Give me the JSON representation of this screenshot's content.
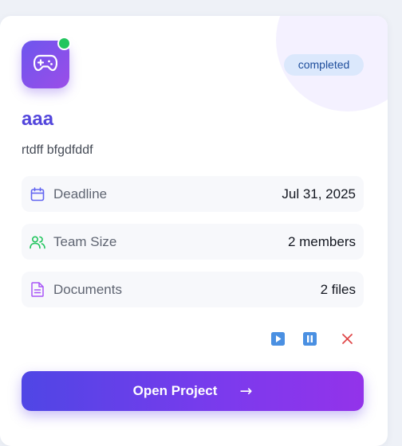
{
  "project": {
    "name": "aaa",
    "description": "rtdff bfgdfddf",
    "status": "completed",
    "icon": "gamepad-icon",
    "online": true
  },
  "details": [
    {
      "icon": "calendar-icon",
      "label": "Deadline",
      "value": "Jul 31, 2025",
      "color": "#6366f1"
    },
    {
      "icon": "users-icon",
      "label": "Team Size",
      "value": "2 members",
      "color": "#22c55e"
    },
    {
      "icon": "document-icon",
      "label": "Documents",
      "value": "2 files",
      "color": "#a855f7"
    }
  ],
  "controls": {
    "play_icon": "play-icon",
    "pause_icon": "pause-icon",
    "close_icon": "close-icon"
  },
  "actions": {
    "open_label": "Open Project",
    "open_arrow": "→"
  },
  "colors": {
    "accent": "#5346dc",
    "status_bg": "#dbe8fc",
    "status_text": "#1f4e9c",
    "online": "#22c55e",
    "close": "#e0484a"
  }
}
